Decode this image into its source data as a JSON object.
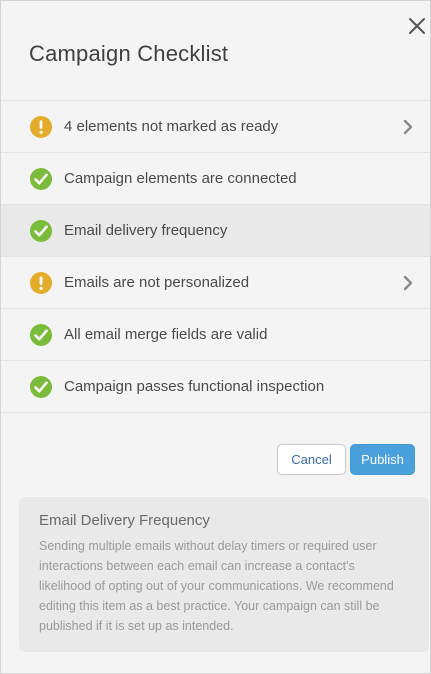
{
  "dialog": {
    "title": "Campaign Checklist",
    "close_icon": "close-icon"
  },
  "colors": {
    "warning": "#e3ac2b",
    "success": "#7bbb3a",
    "publish": "#4aa0db",
    "cancel_text": "#3a6aa5"
  },
  "checklist": [
    {
      "label": "4 elements not marked as ready",
      "status": "warning",
      "has_chevron": true
    },
    {
      "label": "Campaign elements are connected",
      "status": "success",
      "has_chevron": false
    },
    {
      "label": "Email delivery frequency",
      "status": "success",
      "has_chevron": false,
      "selected": true
    },
    {
      "label": "Emails are not personalized",
      "status": "warning",
      "has_chevron": true
    },
    {
      "label": "All email merge fields are valid",
      "status": "success",
      "has_chevron": false
    },
    {
      "label": "Campaign passes functional inspection",
      "status": "success",
      "has_chevron": false
    }
  ],
  "buttons": {
    "cancel": "Cancel",
    "publish": "Publish"
  },
  "info_panel": {
    "title": "Email Delivery Frequency",
    "body": "Sending multiple emails without delay timers or required user interactions between each email can increase a contact's likelihood of opting out of your communications. We recommend editing this item as a best practice. Your campaign can still be published if it is set up as intended."
  }
}
